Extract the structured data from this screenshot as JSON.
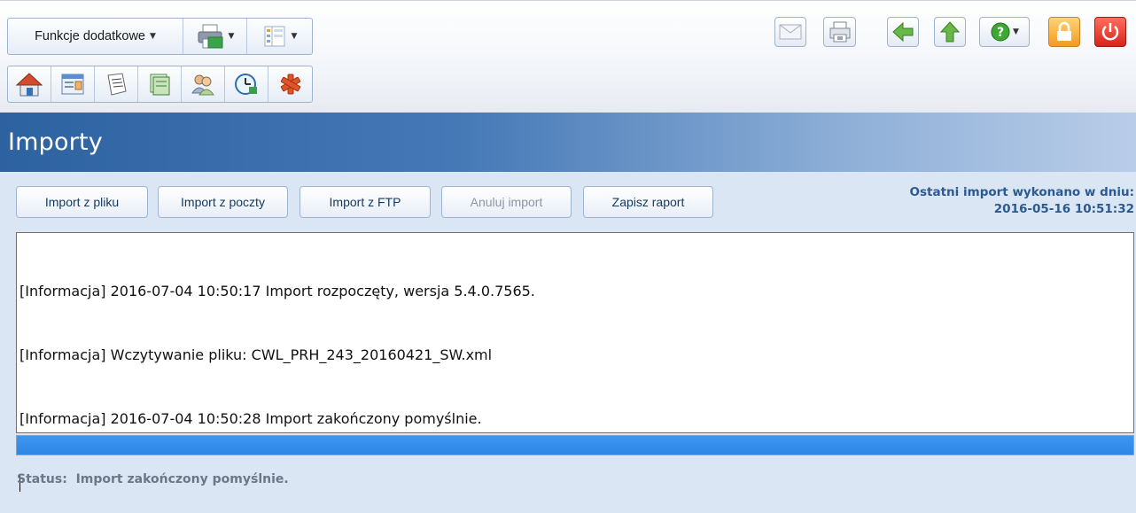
{
  "toolbar": {
    "func_menu_label": "Funkcje dodatkowe",
    "print_icon": "printer-icon",
    "layout_icon": "layout-columns-icon",
    "nav_icons": [
      "home-icon",
      "patient-card-icon",
      "documents-icon",
      "calendar-icon",
      "users-icon",
      "schedule-clock-icon",
      "medical-star-icon"
    ],
    "right_icons": [
      "mail-icon",
      "print-preview-icon",
      "back-arrow-icon",
      "up-arrow-icon",
      "help-icon",
      "lock-icon",
      "power-icon"
    ]
  },
  "page": {
    "title": "Importy"
  },
  "actions": {
    "import_file": "Import z pliku",
    "import_mail": "Import z poczty",
    "import_ftp": "Import z FTP",
    "cancel_import": "Anuluj import",
    "save_report": "Zapisz raport"
  },
  "last_import": {
    "label": "Ostatni import wykonano w dniu:",
    "date": "2016-05-16 10:51:32"
  },
  "log": {
    "lines": [
      "[Informacja] 2016-07-04 10:50:17 Import rozpoczęty, wersja 5.4.0.7565.",
      "[Informacja] Wczytywanie pliku: CWL_PRH_243_20160421_SW.xml",
      "[Informacja] 2016-07-04 10:50:28 Import zakończony pomyślnie."
    ]
  },
  "progress": {
    "percent": 100
  },
  "status": {
    "label": "Status:",
    "text": "Import zakończony pomyślnie."
  },
  "colors": {
    "title_band_start": "#2d62a0",
    "accent_text": "#2b5a93",
    "progress": "#3b96f0"
  }
}
